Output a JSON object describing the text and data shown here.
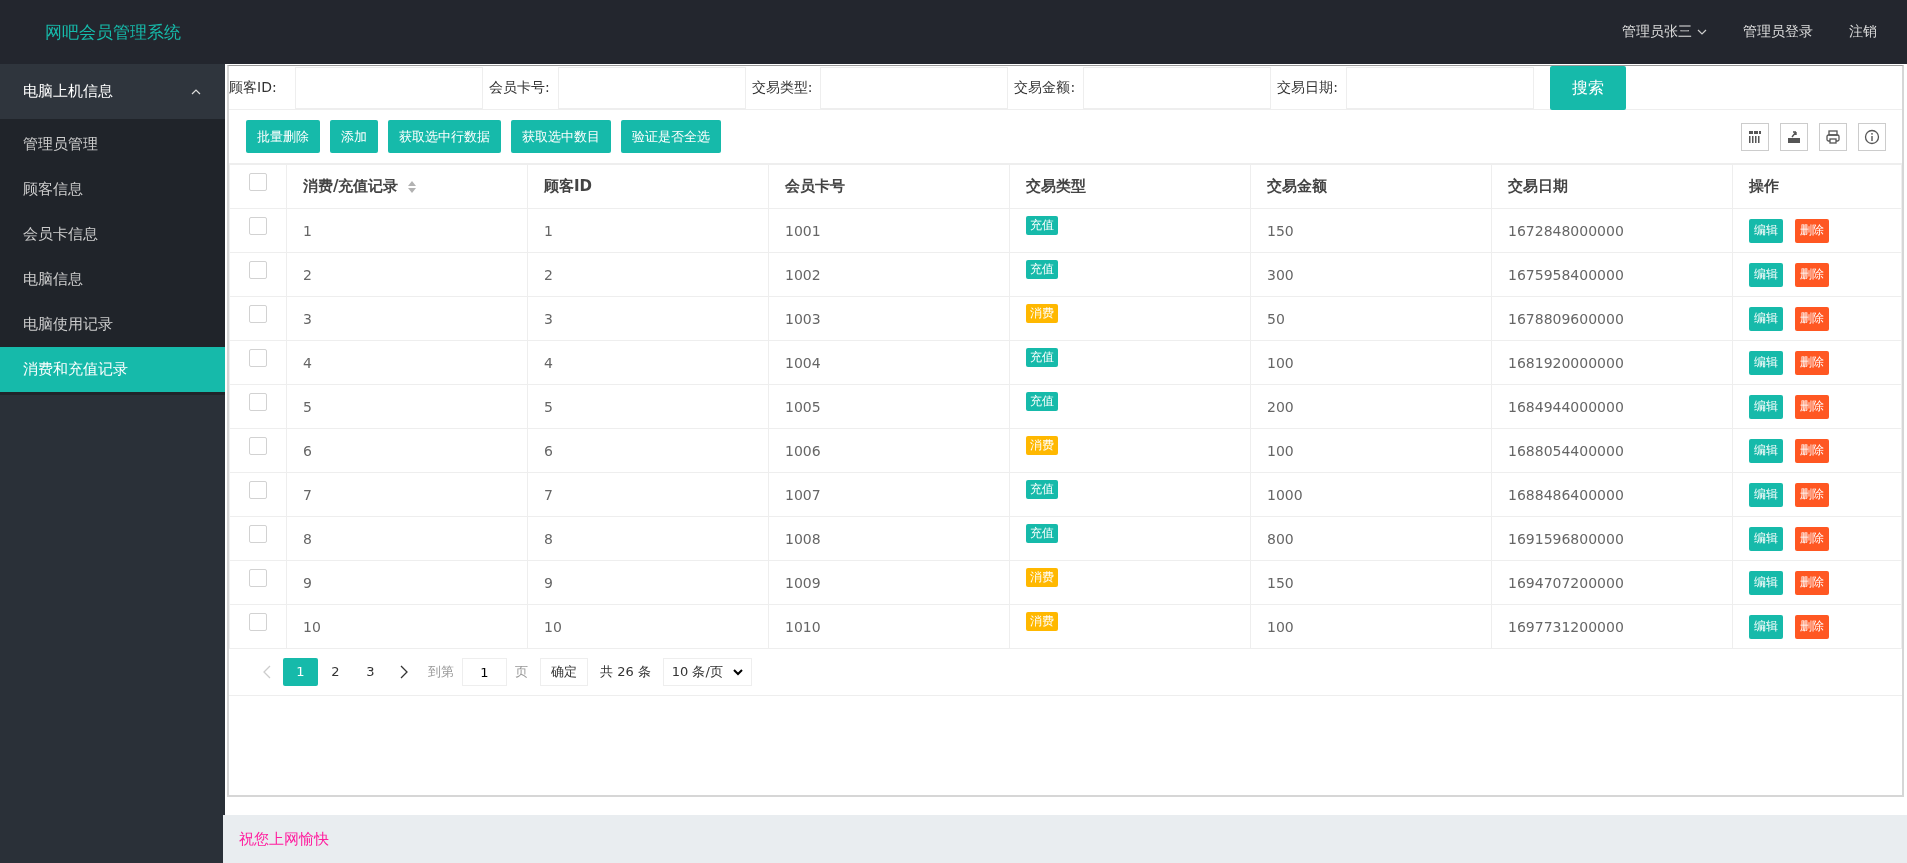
{
  "header": {
    "title": "网吧会员管理系统",
    "nav": [
      {
        "label": "管理员张三",
        "dropdown": true
      },
      {
        "label": "管理员登录",
        "dropdown": false
      },
      {
        "label": "注销",
        "dropdown": false
      }
    ]
  },
  "sidebar": {
    "group": {
      "label": "电脑上机信息",
      "expanded": true
    },
    "items": [
      {
        "label": "管理员管理",
        "selected": false
      },
      {
        "label": "顾客信息",
        "selected": false
      },
      {
        "label": "会员卡信息",
        "selected": false
      },
      {
        "label": "电脑信息",
        "selected": false
      },
      {
        "label": "电脑使用记录",
        "selected": false
      },
      {
        "label": "消费和充值记录",
        "selected": true
      }
    ]
  },
  "search": {
    "fields": [
      {
        "label": "顾客ID:"
      },
      {
        "label": "会员卡号:"
      },
      {
        "label": "交易类型:"
      },
      {
        "label": "交易金额:"
      },
      {
        "label": "交易日期:"
      }
    ],
    "button": "搜索"
  },
  "toolbar": {
    "buttons": [
      "批量删除",
      "添加",
      "获取选中行数据",
      "获取选中数目",
      "验证是否全选"
    ],
    "tools": [
      {
        "kind": "columns"
      },
      {
        "kind": "export"
      },
      {
        "kind": "print"
      },
      {
        "kind": "info"
      }
    ]
  },
  "table": {
    "header_checked": false,
    "columns": [
      {
        "label": "消费/充值记录",
        "sortable": true
      },
      {
        "label": "顾客ID",
        "sortable": false
      },
      {
        "label": "会员卡号",
        "sortable": false
      },
      {
        "label": "交易类型",
        "sortable": false
      },
      {
        "label": "交易金额",
        "sortable": false
      },
      {
        "label": "交易日期",
        "sortable": false
      },
      {
        "label": "操作",
        "sortable": false
      }
    ],
    "rows": [
      {
        "checked": false,
        "record": "1",
        "customer_id": "1",
        "card": "1001",
        "type": {
          "text": "充值",
          "color": "#16baaa"
        },
        "amount": "150",
        "date": "1672848000000",
        "actions": [
          "编辑",
          "删除"
        ]
      },
      {
        "checked": false,
        "record": "2",
        "customer_id": "2",
        "card": "1002",
        "type": {
          "text": "充值",
          "color": "#16baaa"
        },
        "amount": "300",
        "date": "1675958400000",
        "actions": [
          "编辑",
          "删除"
        ]
      },
      {
        "checked": false,
        "record": "3",
        "customer_id": "3",
        "card": "1003",
        "type": {
          "text": "消费",
          "color": "#ffb800"
        },
        "amount": "50",
        "date": "1678809600000",
        "actions": [
          "编辑",
          "删除"
        ]
      },
      {
        "checked": false,
        "record": "4",
        "customer_id": "4",
        "card": "1004",
        "type": {
          "text": "充值",
          "color": "#16baaa"
        },
        "amount": "100",
        "date": "1681920000000",
        "actions": [
          "编辑",
          "删除"
        ]
      },
      {
        "checked": false,
        "record": "5",
        "customer_id": "5",
        "card": "1005",
        "type": {
          "text": "充值",
          "color": "#16baaa"
        },
        "amount": "200",
        "date": "1684944000000",
        "actions": [
          "编辑",
          "删除"
        ]
      },
      {
        "checked": false,
        "record": "6",
        "customer_id": "6",
        "card": "1006",
        "type": {
          "text": "消费",
          "color": "#ffb800"
        },
        "amount": "100",
        "date": "1688054400000",
        "actions": [
          "编辑",
          "删除"
        ]
      },
      {
        "checked": false,
        "record": "7",
        "customer_id": "7",
        "card": "1007",
        "type": {
          "text": "充值",
          "color": "#16baaa"
        },
        "amount": "1000",
        "date": "1688486400000",
        "actions": [
          "编辑",
          "删除"
        ]
      },
      {
        "checked": false,
        "record": "8",
        "customer_id": "8",
        "card": "1008",
        "type": {
          "text": "充值",
          "color": "#16baaa"
        },
        "amount": "800",
        "date": "1691596800000",
        "actions": [
          "编辑",
          "删除"
        ]
      },
      {
        "checked": false,
        "record": "9",
        "customer_id": "9",
        "card": "1009",
        "type": {
          "text": "消费",
          "color": "#ffb800"
        },
        "amount": "150",
        "date": "1694707200000",
        "actions": [
          "编辑",
          "删除"
        ]
      },
      {
        "checked": false,
        "record": "10",
        "customer_id": "10",
        "card": "1010",
        "type": {
          "text": "消费",
          "color": "#ffb800"
        },
        "amount": "100",
        "date": "1697731200000",
        "actions": [
          "编辑",
          "删除"
        ]
      }
    ]
  },
  "pagination": {
    "prev_disabled": true,
    "pages": [
      {
        "label": "1",
        "selected": true
      },
      {
        "label": "2",
        "selected": false
      },
      {
        "label": "3",
        "selected": false
      }
    ],
    "goto_label": "到第",
    "goto_value": "1",
    "page_label": "页",
    "confirm": "确定",
    "total": "共 26 条",
    "page_size": "10 条/页"
  },
  "footer": {
    "text": "祝您上网愉快"
  }
}
